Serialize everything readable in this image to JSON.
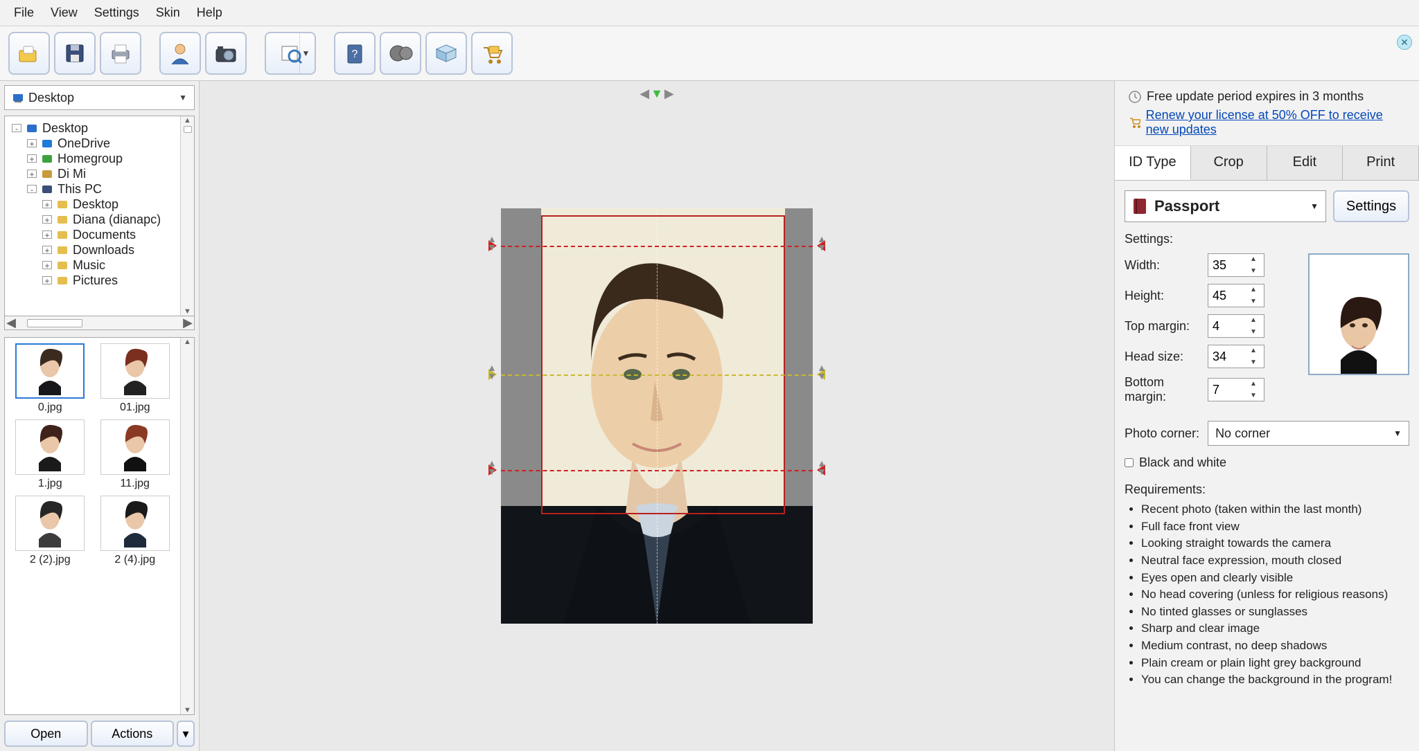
{
  "menu": {
    "file": "File",
    "view": "View",
    "settings": "Settings",
    "skin": "Skin",
    "help": "Help"
  },
  "notice": {
    "line1": "Free update period expires in 3 months",
    "link": "Renew your license at 50% OFF to receive new updates"
  },
  "tabs": {
    "idtype": "ID Type",
    "crop": "Crop",
    "edit": "Edit",
    "print": "Print"
  },
  "idtype": {
    "selected": "Passport",
    "settings_btn": "Settings",
    "settings_label": "Settings:",
    "width_lbl": "Width:",
    "width": "35",
    "height_lbl": "Height:",
    "height": "45",
    "topm_lbl": "Top margin:",
    "topm": "4",
    "head_lbl": "Head size:",
    "head": "34",
    "botm_lbl": "Bottom margin:",
    "botm": "7",
    "corner_lbl": "Photo corner:",
    "corner": "No corner",
    "bw": "Black and white",
    "req_lbl": "Requirements:",
    "reqs": [
      "Recent photo (taken within the last month)",
      "Full face front view",
      "Looking straight towards the camera",
      "Neutral face expression, mouth closed",
      "Eyes open and clearly visible",
      "No head covering (unless for religious reasons)",
      "No tinted glasses or sunglasses",
      "Sharp and clear image",
      "Medium contrast, no deep shadows",
      "Plain cream or plain light grey background",
      "You can change the background in the program!"
    ]
  },
  "left": {
    "location": "Desktop",
    "tree": [
      {
        "ind": 4,
        "tw": "-",
        "ico": "desktop",
        "label": "Desktop"
      },
      {
        "ind": 26,
        "tw": "+",
        "ico": "cloud",
        "label": "OneDrive"
      },
      {
        "ind": 26,
        "tw": "+",
        "ico": "group",
        "label": "Homegroup"
      },
      {
        "ind": 26,
        "tw": "+",
        "ico": "user",
        "label": "Di Mi"
      },
      {
        "ind": 26,
        "tw": "-",
        "ico": "pc",
        "label": "This PC"
      },
      {
        "ind": 48,
        "tw": "+",
        "ico": "folder",
        "label": "Desktop"
      },
      {
        "ind": 48,
        "tw": "+",
        "ico": "folder",
        "label": "Diana (dianapc)"
      },
      {
        "ind": 48,
        "tw": "+",
        "ico": "folder",
        "label": "Documents"
      },
      {
        "ind": 48,
        "tw": "+",
        "ico": "folder",
        "label": "Downloads"
      },
      {
        "ind": 48,
        "tw": "+",
        "ico": "folder",
        "label": "Music"
      },
      {
        "ind": 48,
        "tw": "+",
        "ico": "folder",
        "label": "Pictures"
      }
    ],
    "thumbs": [
      {
        "name": "0.jpg",
        "sel": true,
        "hair": "#3b2b1e",
        "skin": "#e9c7a8",
        "shirt": "#15171b"
      },
      {
        "name": "01.jpg",
        "sel": false,
        "hair": "#7a2f1f",
        "skin": "#e9c7a8",
        "shirt": "#222"
      },
      {
        "name": "1.jpg",
        "sel": false,
        "hair": "#3f221a",
        "skin": "#e9c7a8",
        "shirt": "#1a1a1a"
      },
      {
        "name": "11.jpg",
        "sel": false,
        "hair": "#8a3a24",
        "skin": "#e9c7a8",
        "shirt": "#111"
      },
      {
        "name": "2 (2).jpg",
        "sel": false,
        "hair": "#262626",
        "skin": "#e9c7a8",
        "shirt": "#3c3c3c"
      },
      {
        "name": "2 (4).jpg",
        "sel": false,
        "hair": "#1a1a1a",
        "skin": "#e9c7a8",
        "shirt": "#1f2a3a"
      }
    ],
    "open": "Open",
    "actions": "Actions"
  }
}
